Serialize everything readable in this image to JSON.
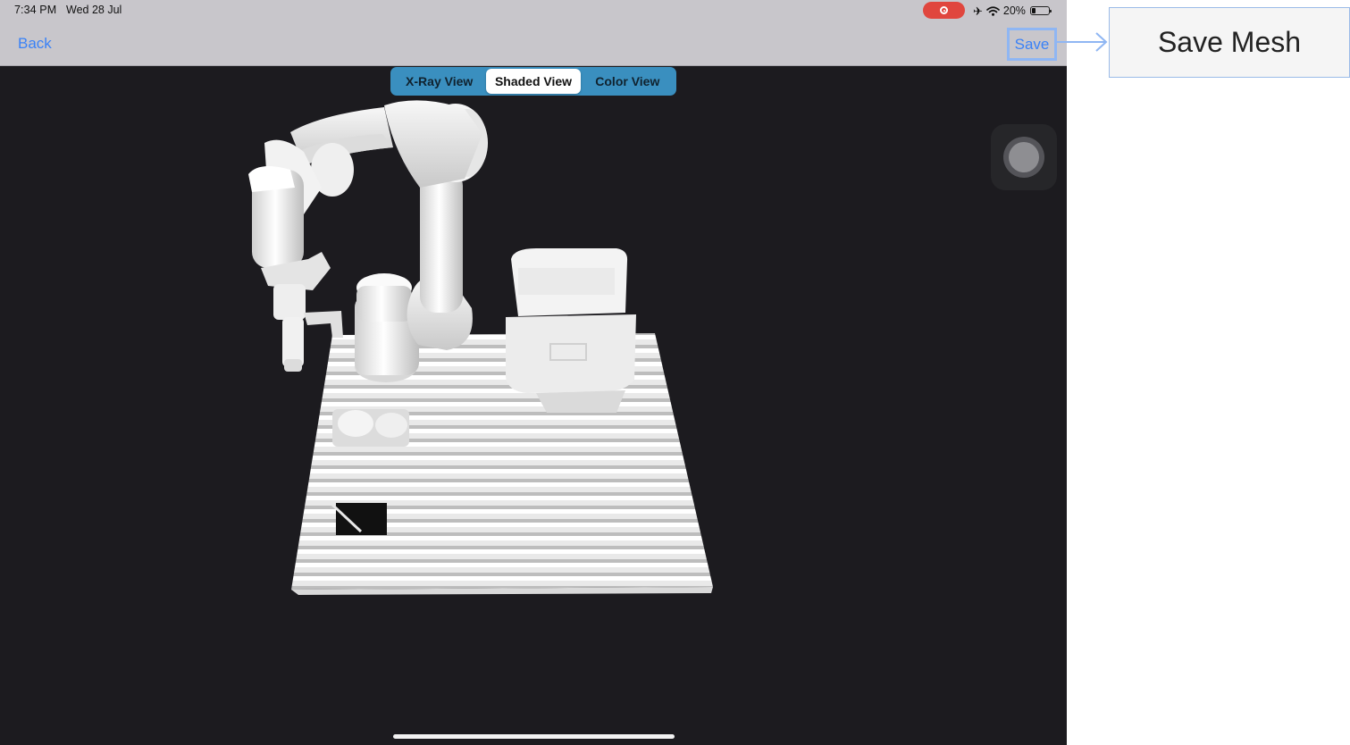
{
  "status_bar": {
    "time": "7:34 PM",
    "date": "Wed 28 Jul",
    "battery": "20%",
    "icons": [
      "screen-recording-icon",
      "airplane-icon",
      "wifi-icon",
      "battery-icon"
    ]
  },
  "nav": {
    "back_label": "Back",
    "save_label": "Save"
  },
  "view_modes": {
    "options": [
      "X-Ray View",
      "Shaded View",
      "Color View"
    ],
    "selected": "Shaded View"
  },
  "viewport": {
    "subject": "3D scanned mesh of robotic arm on slatted table",
    "background": "#1c1b1f",
    "mesh_color": "#f2f2f2"
  },
  "callout": {
    "label": "Save Mesh"
  },
  "colors": {
    "accent": "#3a82f7",
    "segment_bg": "#3a8fbf",
    "nav_bg": "#c8c6cb",
    "record": "#e0463e",
    "highlight": "#8fb6f3"
  }
}
